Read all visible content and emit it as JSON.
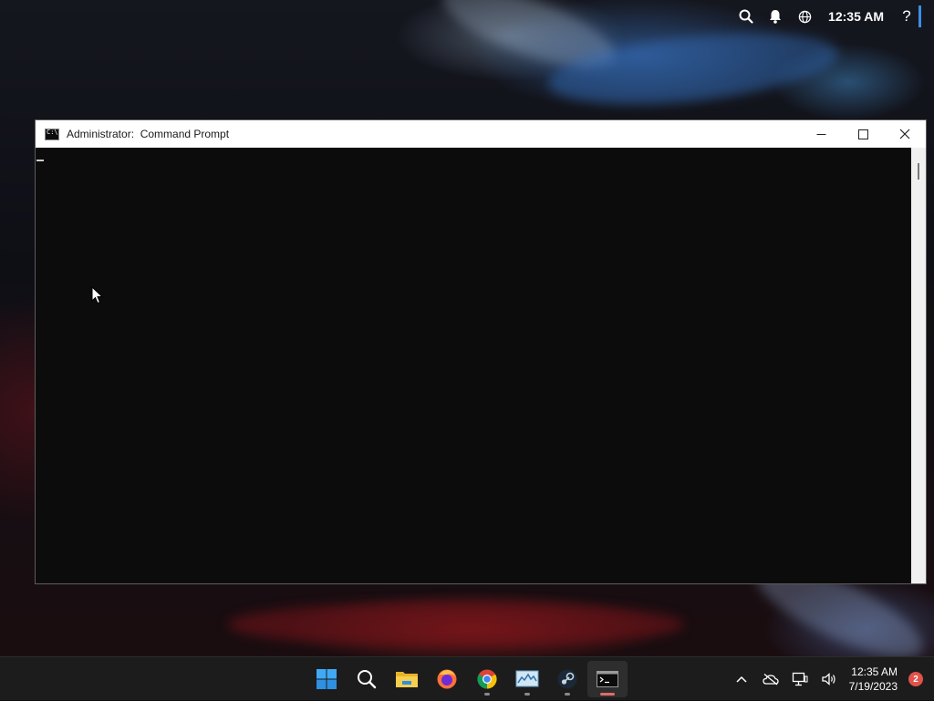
{
  "top_bar": {
    "time": "12:35 AM",
    "help": "?",
    "icons": [
      "search-icon",
      "bell-icon",
      "globe-icon"
    ]
  },
  "window": {
    "title": "Administrator:  Command Prompt",
    "icon": "cmd-icon",
    "controls": [
      "minimize-icon",
      "maximize-icon",
      "close-icon"
    ]
  },
  "taskbar": {
    "apps": [
      {
        "name": "start",
        "icon": "windows-logo-icon"
      },
      {
        "name": "search",
        "icon": "search-icon"
      },
      {
        "name": "file-explorer",
        "icon": "folder-icon"
      },
      {
        "name": "firefox",
        "icon": "firefox-icon"
      },
      {
        "name": "chrome",
        "icon": "chrome-icon"
      },
      {
        "name": "resource-monitor",
        "icon": "monitor-icon"
      },
      {
        "name": "steam",
        "icon": "steam-icon"
      },
      {
        "name": "command-prompt",
        "icon": "cmd-icon"
      }
    ],
    "tray": {
      "icons": [
        "chevron-up-icon",
        "cloud-offline-icon",
        "network-icon",
        "volume-icon"
      ],
      "time": "12:35 AM",
      "date": "7/19/2023",
      "notification_count": "2"
    }
  },
  "colors": {
    "console_bg": "#0c0c0c",
    "taskbar_bg": "#1c1c1c",
    "accent": "#3a8ee6",
    "badge": "#e0534b"
  }
}
